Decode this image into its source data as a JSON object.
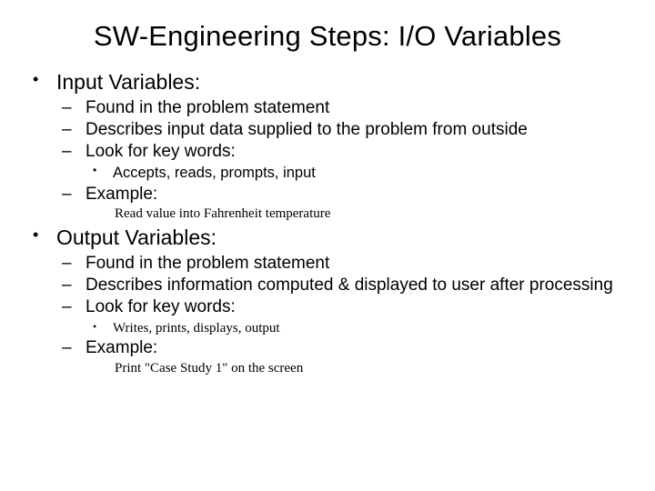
{
  "title": "SW-Engineering Steps: I/O Variables",
  "input": {
    "heading": "Input Variables:",
    "points": {
      "p1": "Found in the problem statement",
      "p2": "Describes input data supplied to the problem from outside",
      "p3": "Look for key words:",
      "keywords": "Accepts, reads, prompts, input",
      "example_label": "Example:",
      "example_text": "Read value into Fahrenheit temperature"
    }
  },
  "output": {
    "heading": "Output Variables:",
    "points": {
      "p1": "Found in the problem statement",
      "p2": "Describes information computed & displayed to user after processing",
      "p3": "Look for key words:",
      "keywords": "Writes, prints, displays, output",
      "example_label": "Example:",
      "example_text": "Print \"Case Study 1\" on the screen"
    }
  }
}
